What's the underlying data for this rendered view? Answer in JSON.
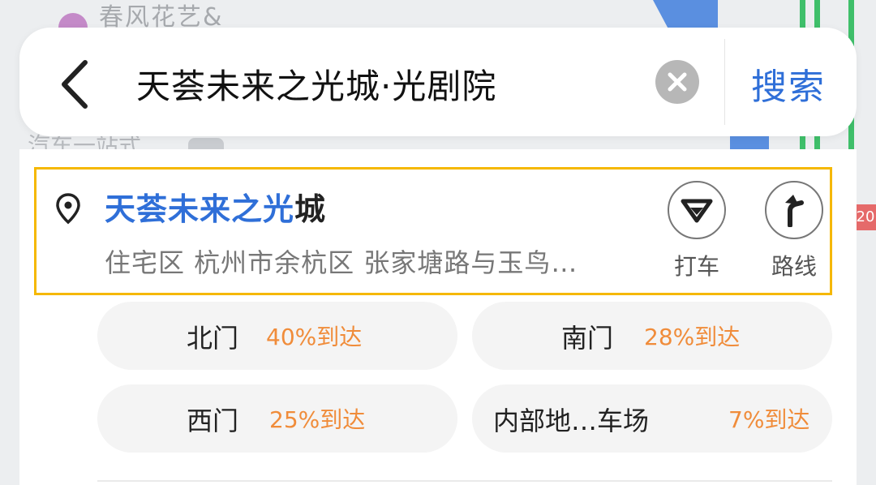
{
  "map": {
    "poi_label": "春风花艺&",
    "street_label": "汽车一站式"
  },
  "search": {
    "query": "天荟未来之光城·光剧院",
    "button_label": "搜索"
  },
  "result": {
    "title_highlight": "天荟未来之光",
    "title_rest": "城",
    "subtitle": "住宅区 杭州市余杭区 张家塘路与玉鸟…",
    "actions": {
      "taxi_label": "打车",
      "route_label": "路线"
    }
  },
  "entrances": [
    {
      "name": "北门",
      "rate": "40%到达"
    },
    {
      "name": "南门",
      "rate": "28%到达"
    },
    {
      "name": "西门",
      "rate": "25%到达"
    },
    {
      "name": "内部地…车场",
      "rate": "7%到达"
    }
  ],
  "colors": {
    "accent_blue": "#2f6fd8",
    "highlight_border": "#f5b800",
    "rate_orange": "#f08c3a"
  },
  "side_badge": "20"
}
